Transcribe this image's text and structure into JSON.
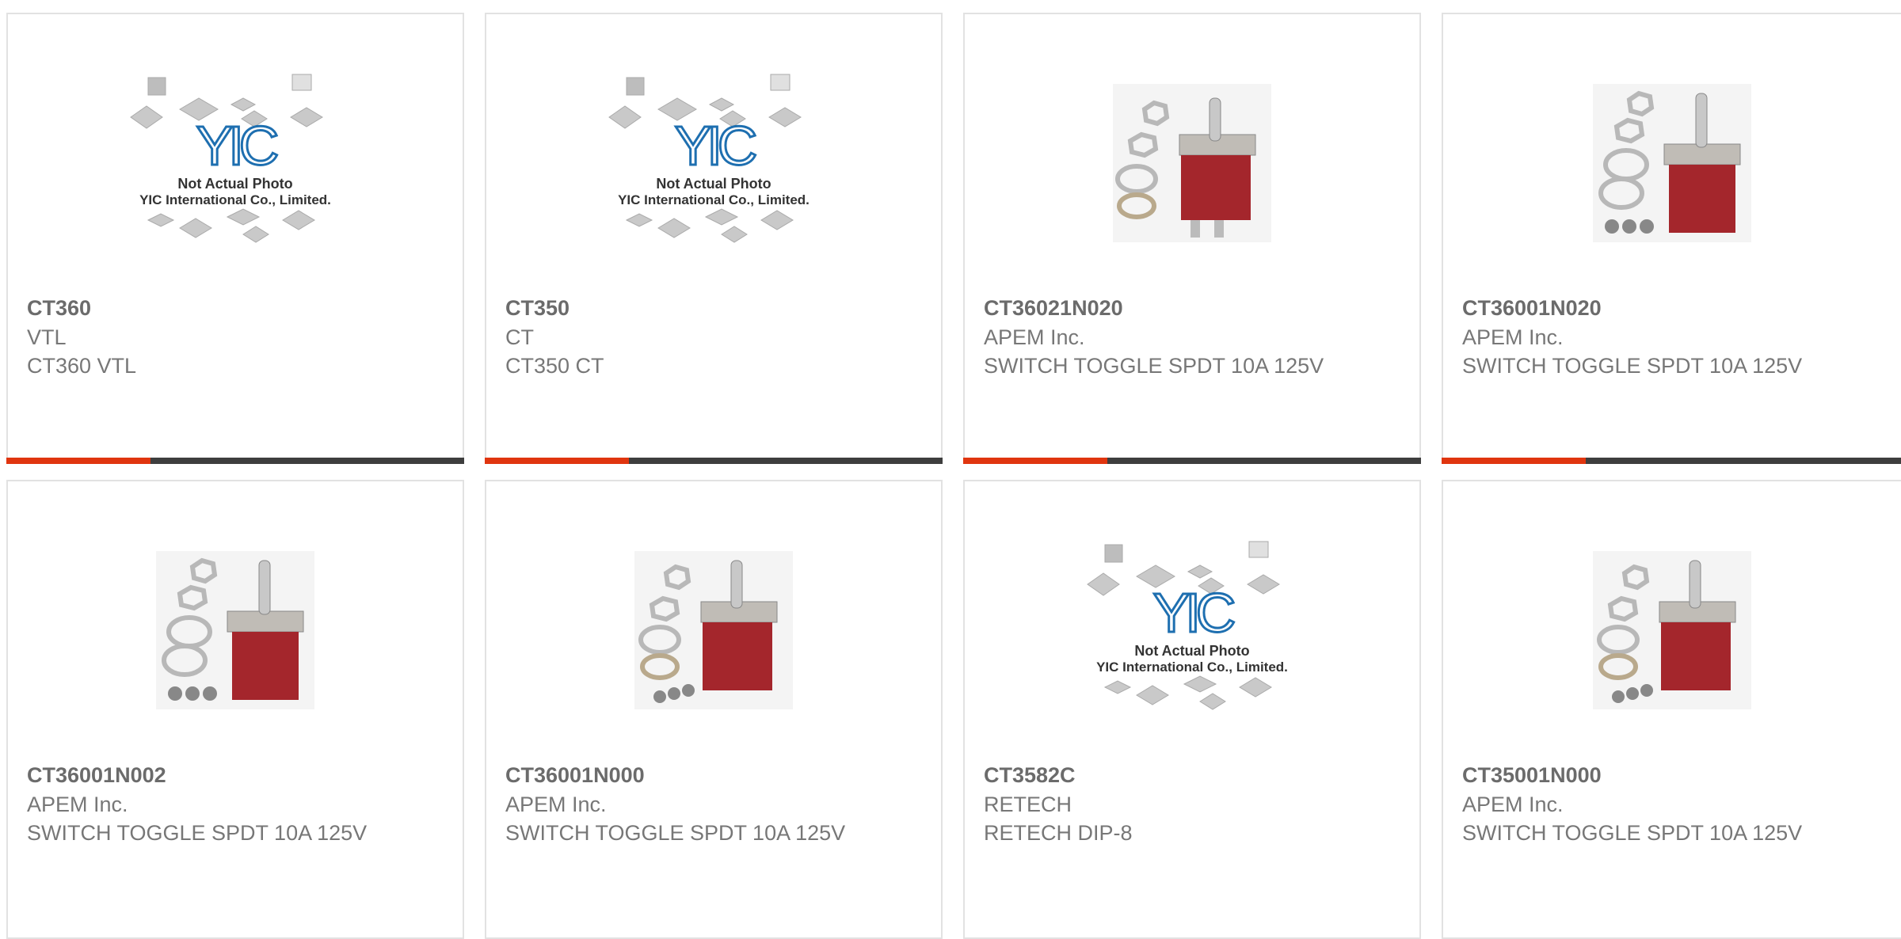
{
  "colors": {
    "accent": "#e0350f",
    "bar_dark": "#3e3e3e",
    "card_border": "#e2e2e2"
  },
  "placeholder_image": {
    "line1": "Not Actual Photo",
    "line2": "YIC International Co., Limited."
  },
  "products": [
    {
      "part": "CT360",
      "manufacturer": "VTL",
      "description": "CT360 VTL",
      "image": "placeholder"
    },
    {
      "part": "CT350",
      "manufacturer": "CT",
      "description": "CT350 CT",
      "image": "placeholder"
    },
    {
      "part": "CT36021N020",
      "manufacturer": "APEM Inc.",
      "description": "SWITCH TOGGLE SPDT 10A 125V",
      "image": "toggle-switch"
    },
    {
      "part": "CT36001N020",
      "manufacturer": "APEM Inc.",
      "description": "SWITCH TOGGLE SPDT 10A 125V",
      "image": "toggle-switch"
    },
    {
      "part": "CT36001N002",
      "manufacturer": "APEM Inc.",
      "description": "SWITCH TOGGLE SPDT 10A 125V",
      "image": "toggle-switch"
    },
    {
      "part": "CT36001N000",
      "manufacturer": "APEM Inc.",
      "description": "SWITCH TOGGLE SPDT 10A 125V",
      "image": "toggle-switch"
    },
    {
      "part": "CT3582C",
      "manufacturer": "RETECH",
      "description": "RETECH DIP-8",
      "image": "placeholder"
    },
    {
      "part": "CT35001N000",
      "manufacturer": "APEM Inc.",
      "description": "SWITCH TOGGLE SPDT 10A 125V",
      "image": "toggle-switch"
    }
  ]
}
